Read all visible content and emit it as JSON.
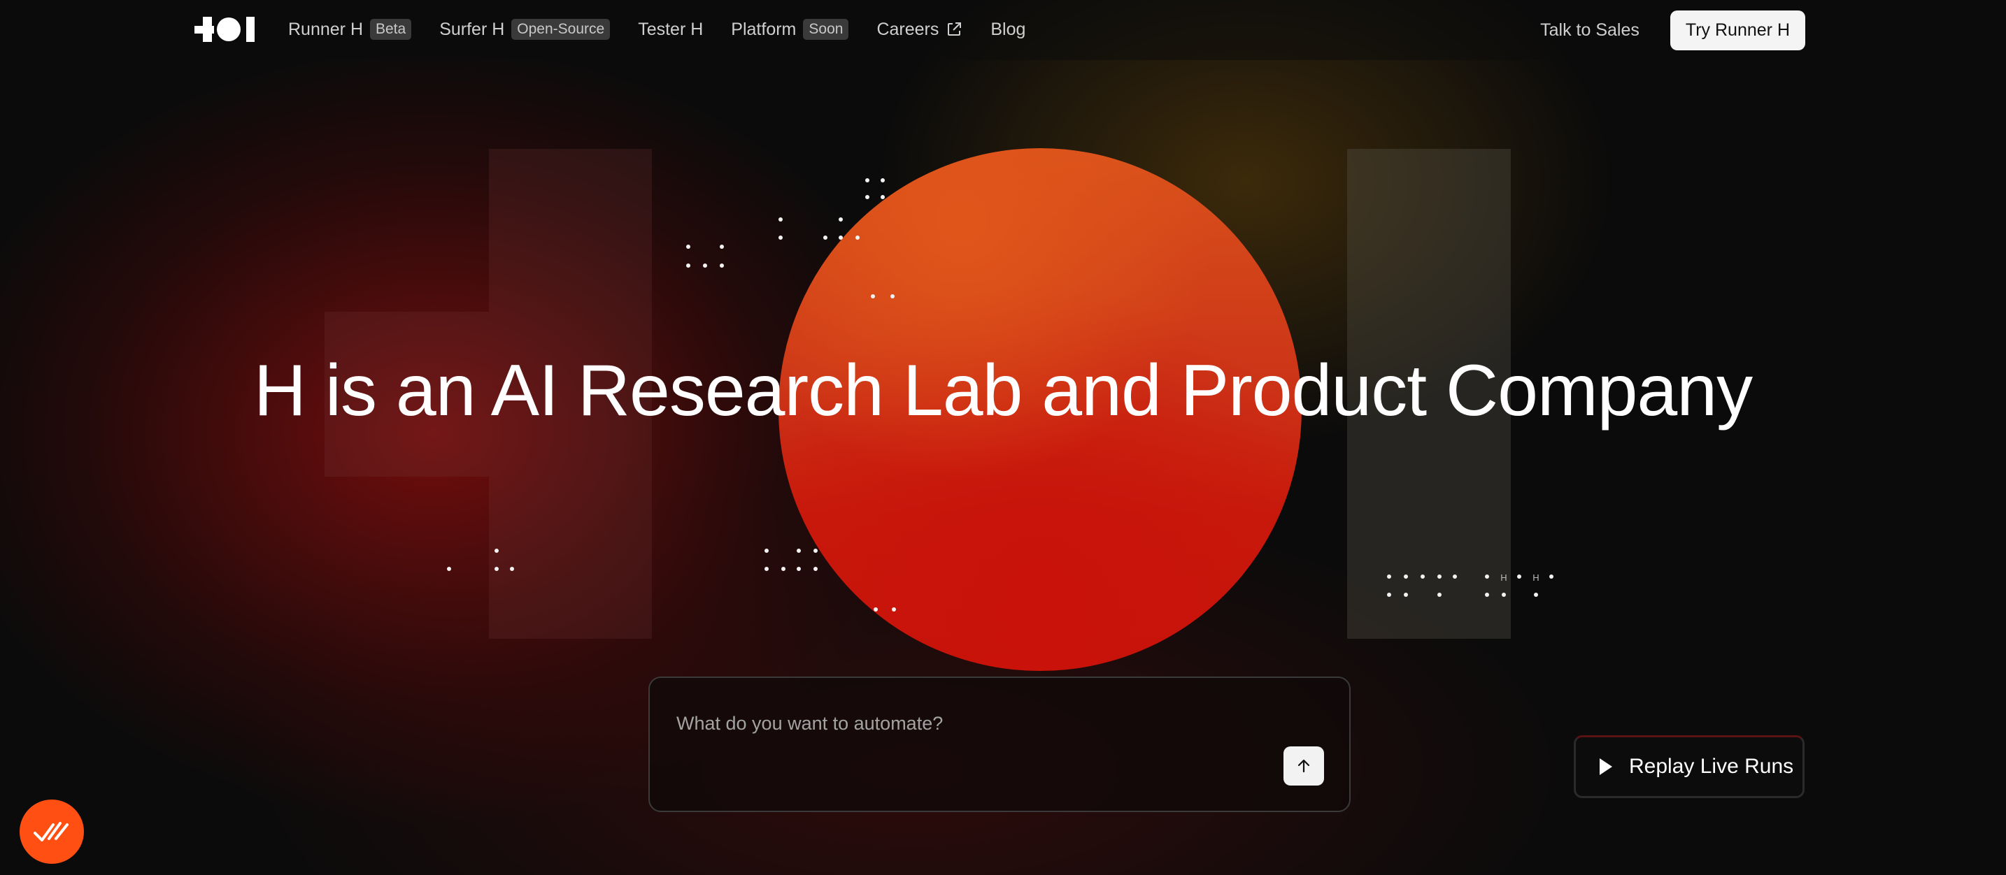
{
  "nav": {
    "items": [
      {
        "label": "Runner H",
        "badge": "Beta"
      },
      {
        "label": "Surfer H",
        "badge": "Open-Source"
      },
      {
        "label": "Tester H",
        "badge": ""
      },
      {
        "label": "Platform",
        "badge": "Soon"
      },
      {
        "label": "Careers",
        "badge": ""
      },
      {
        "label": "Blog",
        "badge": ""
      }
    ],
    "talk_to_sales": "Talk to Sales",
    "try_button": "Try Runner H"
  },
  "hero": {
    "headline": "H is an AI Research Lab and Product Company",
    "dot_label_1": "H",
    "dot_label_2": "H"
  },
  "prompt": {
    "placeholder": "What do you want to automate?",
    "value": ""
  },
  "replay": {
    "label": "Replay Live Runs"
  },
  "colors": {
    "accent": "#ff4f12",
    "circle": "#cc3417",
    "button_bg": "#f4f4f4"
  }
}
